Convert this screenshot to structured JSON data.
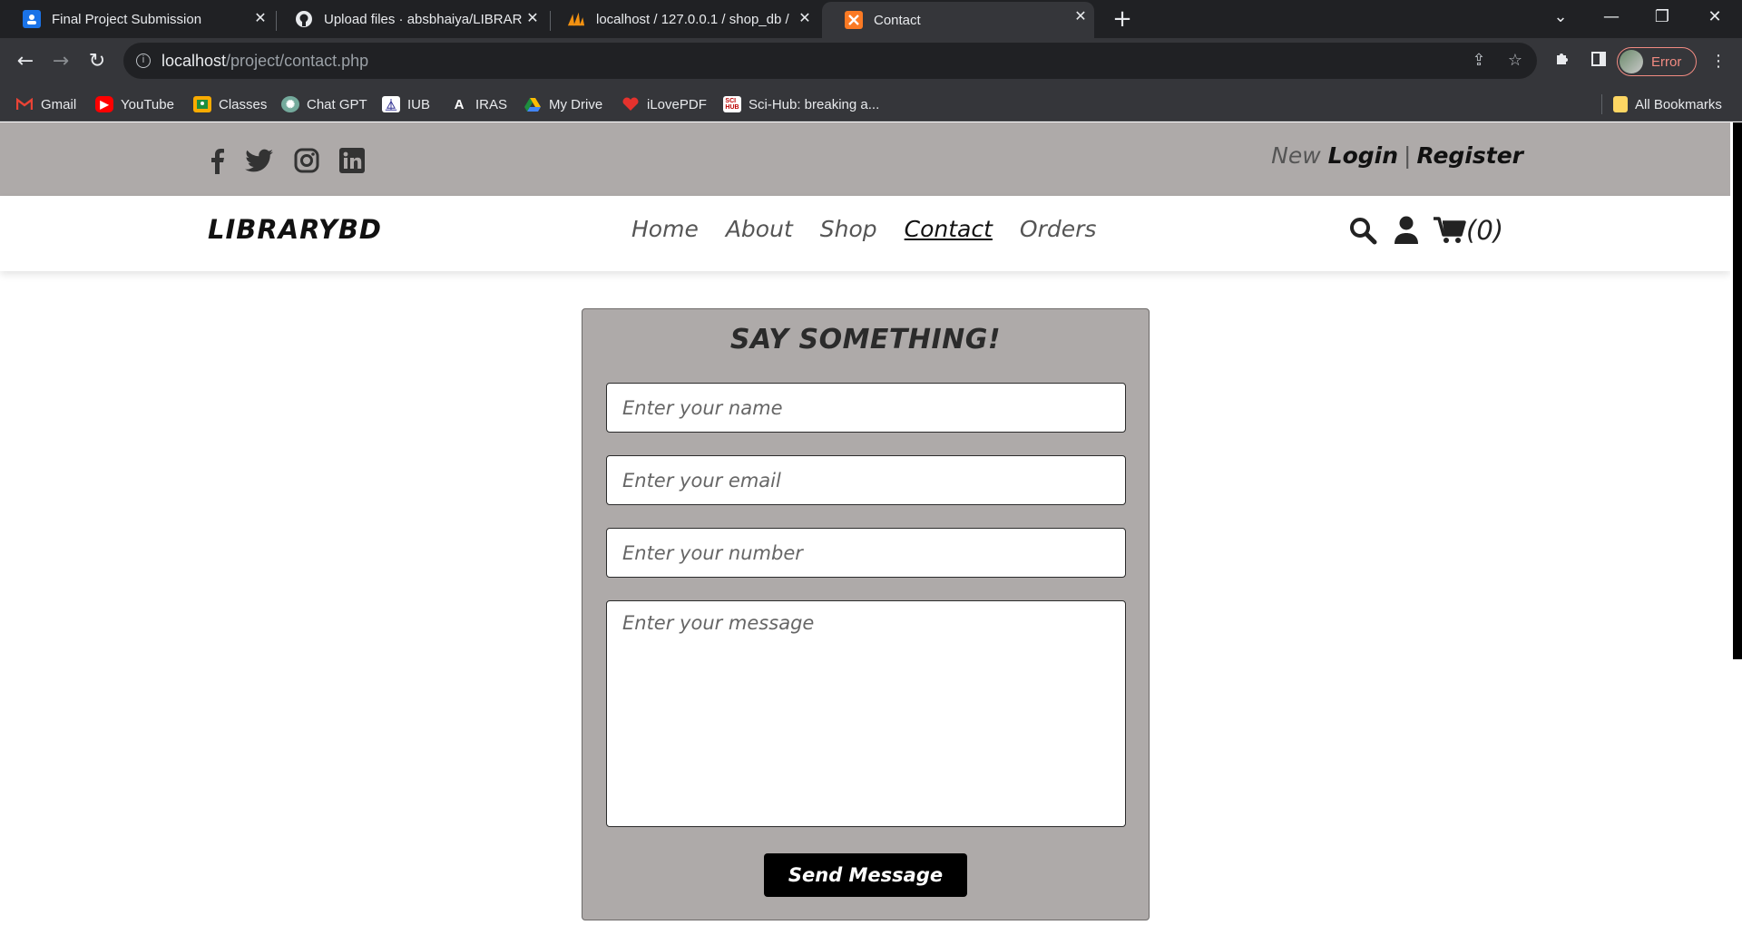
{
  "browser": {
    "tabs": [
      {
        "title": "Final Project Submission",
        "icon": "google-classroom-icon"
      },
      {
        "title": "Upload files · absbhaiya/LIBRAR",
        "icon": "github-icon"
      },
      {
        "title": "localhost / 127.0.0.1 / shop_db / ",
        "icon": "phpmyadmin-icon"
      },
      {
        "title": "Contact",
        "icon": "xampp-icon"
      }
    ],
    "address": {
      "host": "localhost",
      "path": "/project/contact.php"
    },
    "profile_status": "Error",
    "bookmarks": [
      {
        "label": "Gmail",
        "icon": "gmail-icon"
      },
      {
        "label": "YouTube",
        "icon": "youtube-icon"
      },
      {
        "label": "Classes",
        "icon": "classroom-icon"
      },
      {
        "label": "Chat GPT",
        "icon": "chatgpt-icon"
      },
      {
        "label": "IUB",
        "icon": "iub-icon"
      },
      {
        "label": "IRAS",
        "icon": "iras-icon"
      },
      {
        "label": "My Drive",
        "icon": "google-drive-icon"
      },
      {
        "label": "iLovePDF",
        "icon": "ilovepdf-icon"
      },
      {
        "label": "Sci-Hub: breaking a...",
        "icon": "scihub-icon"
      }
    ],
    "all_bookmarks": "All Bookmarks"
  },
  "header": {
    "social": [
      "facebook-icon",
      "twitter-icon",
      "instagram-icon",
      "linkedin-icon"
    ],
    "auth": {
      "prefix": "New",
      "login": "Login",
      "separator": "|",
      "register": "Register"
    }
  },
  "nav": {
    "logo": "LIBRARYBD",
    "links": [
      "Home",
      "About",
      "Shop",
      "Contact",
      "Orders"
    ],
    "active": "Contact",
    "cart_count": "(0)"
  },
  "form": {
    "heading": "SAY SOMETHING!",
    "name_placeholder": "Enter your name",
    "email_placeholder": "Enter your email",
    "number_placeholder": "Enter your number",
    "message_placeholder": "Enter your message",
    "submit_label": "Send Message"
  },
  "colors": {
    "strip": "#aeaaa9",
    "button": "#000000",
    "profile_error": "#f28b82"
  }
}
